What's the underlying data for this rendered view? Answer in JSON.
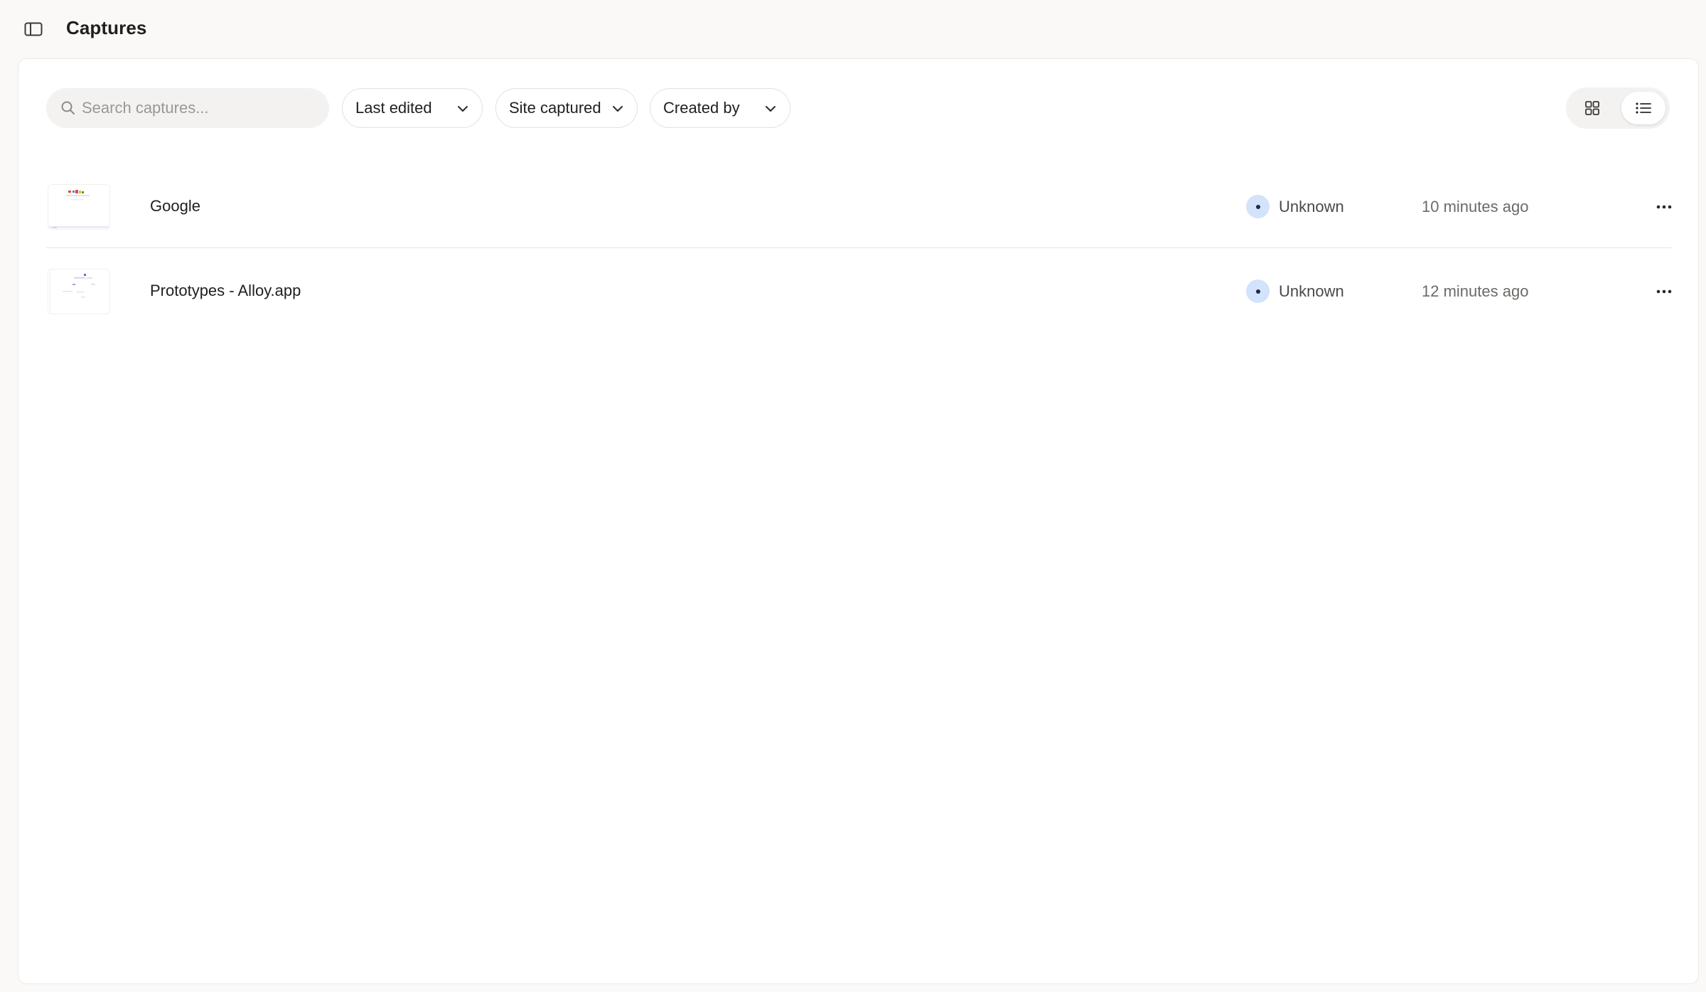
{
  "header": {
    "title": "Captures",
    "toggle_icon": "sidebar-panel-icon"
  },
  "toolbar": {
    "search": {
      "placeholder": "Search captures...",
      "value": ""
    },
    "filters": [
      {
        "label": "Last edited"
      },
      {
        "label": "Site captured"
      },
      {
        "label": "Created by"
      }
    ],
    "view_modes": [
      "grid",
      "list"
    ],
    "active_view": "list"
  },
  "captures": [
    {
      "title": "Google",
      "owner": "Unknown",
      "time": "10 minutes ago"
    },
    {
      "title": "Prototypes - Alloy.app",
      "owner": "Unknown",
      "time": "12 minutes ago"
    }
  ],
  "colors": {
    "background": "#faf9f7",
    "panel": "#ffffff",
    "avatar": "#d3e3fb",
    "text": "#1f1f1f",
    "muted": "#6b6a67"
  }
}
